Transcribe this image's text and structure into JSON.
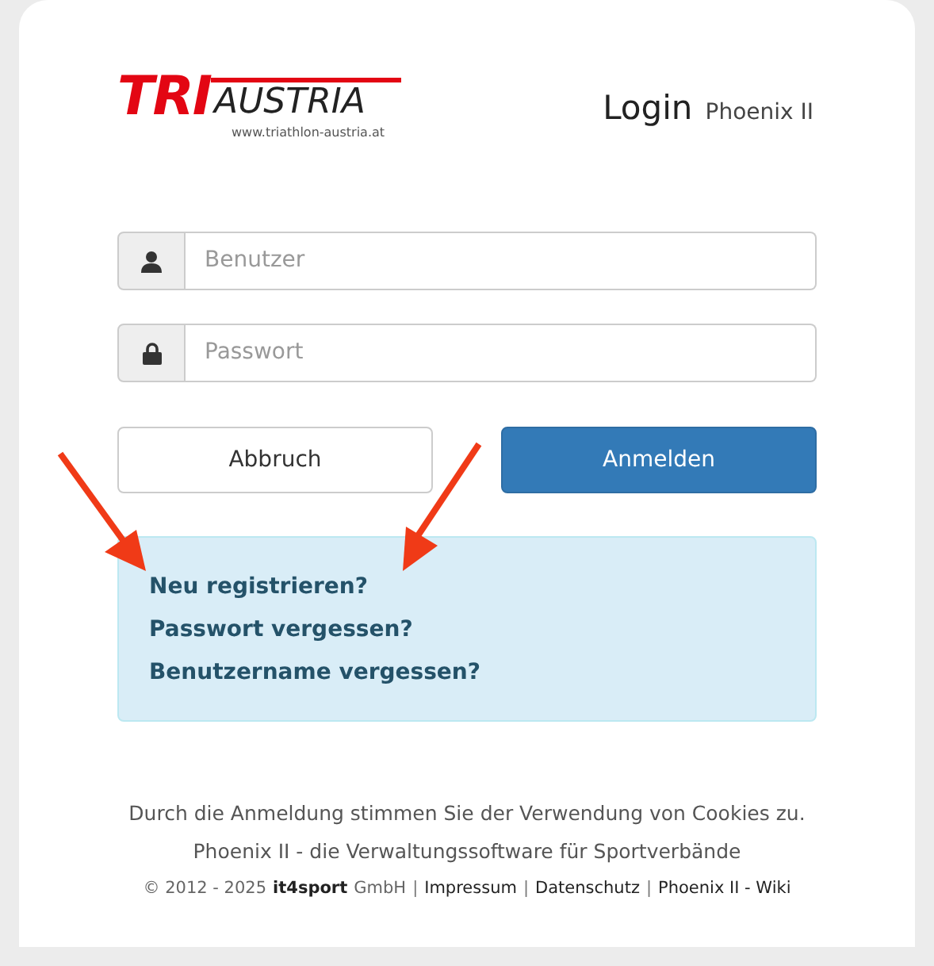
{
  "logo": {
    "brand_left": "TRI",
    "brand_right": "AUSTRIA",
    "url": "www.triathlon-austria.at"
  },
  "heading": {
    "title": "Login",
    "subtitle": "Phoenix II"
  },
  "fields": [
    {
      "kind": "user",
      "placeholder": "Benutzer"
    },
    {
      "kind": "password",
      "placeholder": "Passwort"
    }
  ],
  "buttons": [
    {
      "kind": "default",
      "label": "Abbruch"
    },
    {
      "kind": "primary",
      "label": "Anmelden"
    }
  ],
  "help_links": [
    "Neu registrieren?",
    "Passwort vergessen?",
    "Benutzername vergessen?"
  ],
  "footer": {
    "cookie_note": "Durch die Anmeldung stimmen Sie der Verwendung von Cookies zu.",
    "tagline": "Phoenix II - die Verwaltungssoftware für Sportverbände",
    "bottom_line": [
      {
        "kind": "text",
        "text": "© 2012 - 2025"
      },
      {
        "kind": "link",
        "text": "it4sport"
      },
      {
        "kind": "text",
        "text": "GmbH"
      },
      {
        "kind": "separator",
        "text": "|"
      },
      {
        "kind": "link",
        "text": "Impressum"
      },
      {
        "kind": "separator",
        "text": "|"
      },
      {
        "kind": "link",
        "text": "Datenschutz"
      },
      {
        "kind": "separator",
        "text": "|"
      },
      {
        "kind": "link",
        "text": "Phoenix II - Wiki"
      }
    ]
  }
}
